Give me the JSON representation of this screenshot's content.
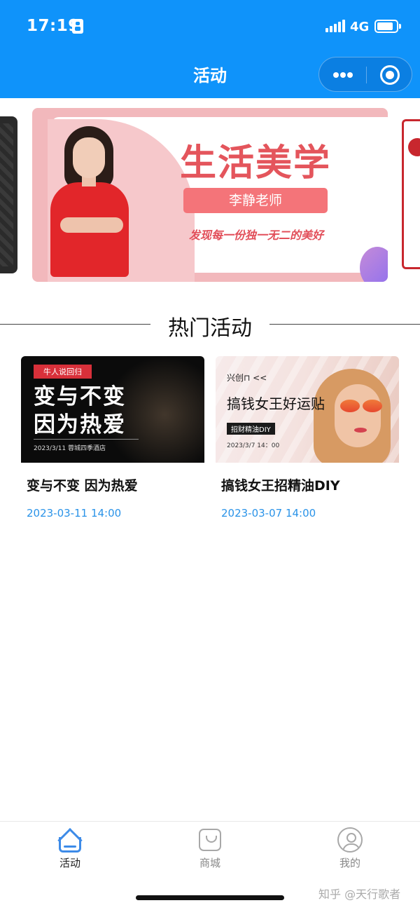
{
  "status_bar": {
    "time": "17:19",
    "network": "4G"
  },
  "nav": {
    "title": "活动",
    "more_icon": "more-dots-icon",
    "close_icon": "miniprogram-close-icon"
  },
  "banner": {
    "title": "生活美学",
    "teacher": "李静老师",
    "slogan": "发现每一份独一无二的美好"
  },
  "section": {
    "title": "热门活动"
  },
  "activities": [
    {
      "title": "变与不变 因为热爱",
      "date": "2023-03-11 14:00",
      "thumb": {
        "tag": "牛人说回归",
        "line1": "变与不变",
        "line2": "因为热爱",
        "footer": "2023/3/11    蓉城四季酒店"
      }
    },
    {
      "title": "搞钱女王招精油DIY",
      "date": "2023-03-07 14:00",
      "thumb": {
        "brand": "兴创⊓ <<",
        "headline": "搞钱女王好运贴",
        "sub": "招财精油DIY",
        "footer": "2023/3/7     14：00"
      }
    }
  ],
  "tabbar": {
    "items": [
      {
        "label": "活动",
        "icon": "home-icon",
        "active": true
      },
      {
        "label": "商城",
        "icon": "shopping-bag-icon",
        "active": false
      },
      {
        "label": "我的",
        "icon": "user-profile-icon",
        "active": false
      }
    ]
  },
  "watermark": "知乎 @天行歌者",
  "colors": {
    "header_blue": "#0f93fa",
    "date_blue": "#2a93e8",
    "accent_red": "#e4555c"
  }
}
